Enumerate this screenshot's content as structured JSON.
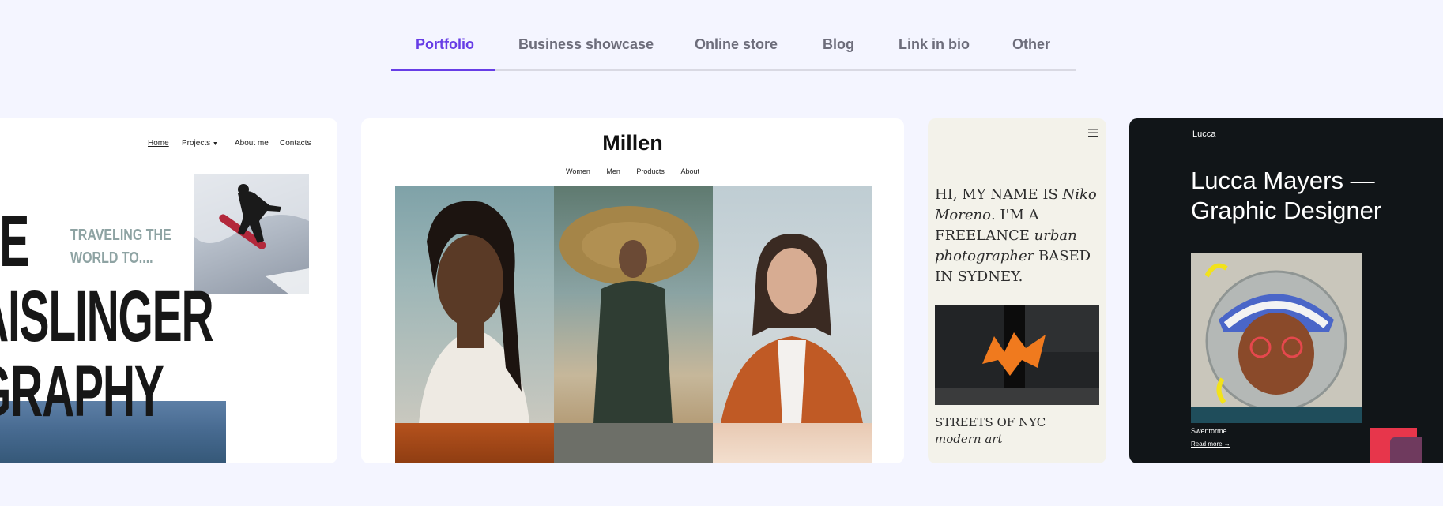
{
  "tabs": [
    {
      "label": "Portfolio",
      "active": true
    },
    {
      "label": "Business showcase",
      "active": false
    },
    {
      "label": "Online store",
      "active": false
    },
    {
      "label": "Blog",
      "active": false
    },
    {
      "label": "Link in bio",
      "active": false
    },
    {
      "label": "Other",
      "active": false
    }
  ],
  "accent_color": "#673de6",
  "card1": {
    "nav": {
      "home": "Home",
      "projects": "Projects",
      "projects_icon": "caret-down",
      "about": "About me",
      "contacts": "Contacts"
    },
    "line1": "IIE",
    "line2": "AISLINGER",
    "line3": "GRAPHY",
    "tagline_1": "TRAVELING THE",
    "tagline_2": "WORLD TO...."
  },
  "card2": {
    "brand": "Millen",
    "menu": [
      "Women",
      "Men",
      "Products",
      "About"
    ]
  },
  "card3": {
    "menu_icon": "hamburger",
    "intro_1": "HI, MY NAME IS ",
    "intro_name": "Niko Moreno",
    "intro_2": ". I'M A FREELANCE ",
    "intro_role": "urban photographer",
    "intro_3": " BASED IN SYDNEY.",
    "caption_1": "STREETS OF NYC",
    "caption_2": "modern art"
  },
  "card4": {
    "logo": "Lucca",
    "title": "Lucca Mayers — Graphic Designer",
    "caption": "Swentorme",
    "read_more": "Read more →"
  }
}
